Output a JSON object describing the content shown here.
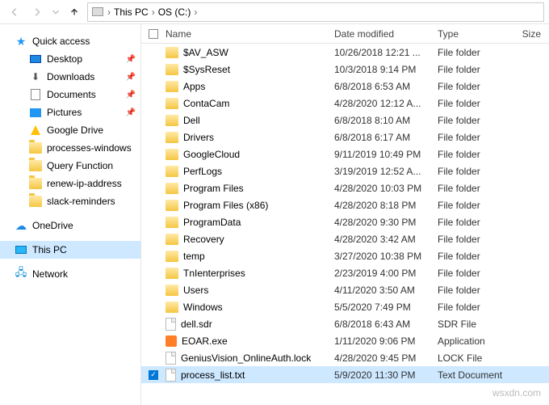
{
  "toolbar": {
    "breadcrumb": [
      "This PC",
      "OS (C:)"
    ]
  },
  "nav": {
    "quick": {
      "label": "Quick access"
    },
    "desktop": {
      "label": "Desktop"
    },
    "downloads": {
      "label": "Downloads"
    },
    "documents": {
      "label": "Documents"
    },
    "pictures": {
      "label": "Pictures"
    },
    "gdrive": {
      "label": "Google Drive"
    },
    "procwin": {
      "label": "processes-windows"
    },
    "queryfn": {
      "label": "Query Function"
    },
    "renewip": {
      "label": "renew-ip-address"
    },
    "slack": {
      "label": "slack-reminders"
    },
    "onedrive": {
      "label": "OneDrive"
    },
    "thispc": {
      "label": "This PC"
    },
    "network": {
      "label": "Network"
    }
  },
  "columns": {
    "name": "Name",
    "date": "Date modified",
    "type": "Type",
    "size": "Size"
  },
  "files": [
    {
      "name": "$AV_ASW",
      "date": "10/26/2018 12:21 ...",
      "type": "File folder",
      "icon": "folder"
    },
    {
      "name": "$SysReset",
      "date": "10/3/2018 9:14 PM",
      "type": "File folder",
      "icon": "folder"
    },
    {
      "name": "Apps",
      "date": "6/8/2018 6:53 AM",
      "type": "File folder",
      "icon": "folder"
    },
    {
      "name": "ContaCam",
      "date": "4/28/2020 12:12 A...",
      "type": "File folder",
      "icon": "folder"
    },
    {
      "name": "Dell",
      "date": "6/8/2018 8:10 AM",
      "type": "File folder",
      "icon": "folder"
    },
    {
      "name": "Drivers",
      "date": "6/8/2018 6:17 AM",
      "type": "File folder",
      "icon": "folder"
    },
    {
      "name": "GoogleCloud",
      "date": "9/11/2019 10:49 PM",
      "type": "File folder",
      "icon": "folder"
    },
    {
      "name": "PerfLogs",
      "date": "3/19/2019 12:52 A...",
      "type": "File folder",
      "icon": "folder"
    },
    {
      "name": "Program Files",
      "date": "4/28/2020 10:03 PM",
      "type": "File folder",
      "icon": "folder"
    },
    {
      "name": "Program Files (x86)",
      "date": "4/28/2020 8:18 PM",
      "type": "File folder",
      "icon": "folder"
    },
    {
      "name": "ProgramData",
      "date": "4/28/2020 9:30 PM",
      "type": "File folder",
      "icon": "folder"
    },
    {
      "name": "Recovery",
      "date": "4/28/2020 3:42 AM",
      "type": "File folder",
      "icon": "folder"
    },
    {
      "name": "temp",
      "date": "3/27/2020 10:38 PM",
      "type": "File folder",
      "icon": "folder"
    },
    {
      "name": "TnIenterprises",
      "date": "2/23/2019 4:00 PM",
      "type": "File folder",
      "icon": "folder"
    },
    {
      "name": "Users",
      "date": "4/11/2020 3:50 AM",
      "type": "File folder",
      "icon": "folder"
    },
    {
      "name": "Windows",
      "date": "5/5/2020 7:49 PM",
      "type": "File folder",
      "icon": "folder"
    },
    {
      "name": "dell.sdr",
      "date": "6/8/2018 6:43 AM",
      "type": "SDR File",
      "icon": "file"
    },
    {
      "name": "EOAR.exe",
      "date": "1/11/2020 9:06 PM",
      "type": "Application",
      "icon": "exe"
    },
    {
      "name": "GeniusVision_OnlineAuth.lock",
      "date": "4/28/2020 9:45 PM",
      "type": "LOCK File",
      "icon": "file"
    },
    {
      "name": "process_list.txt",
      "date": "5/9/2020 11:30 PM",
      "type": "Text Document",
      "icon": "file",
      "selected": true
    }
  ],
  "watermark": "wsxdn.com"
}
